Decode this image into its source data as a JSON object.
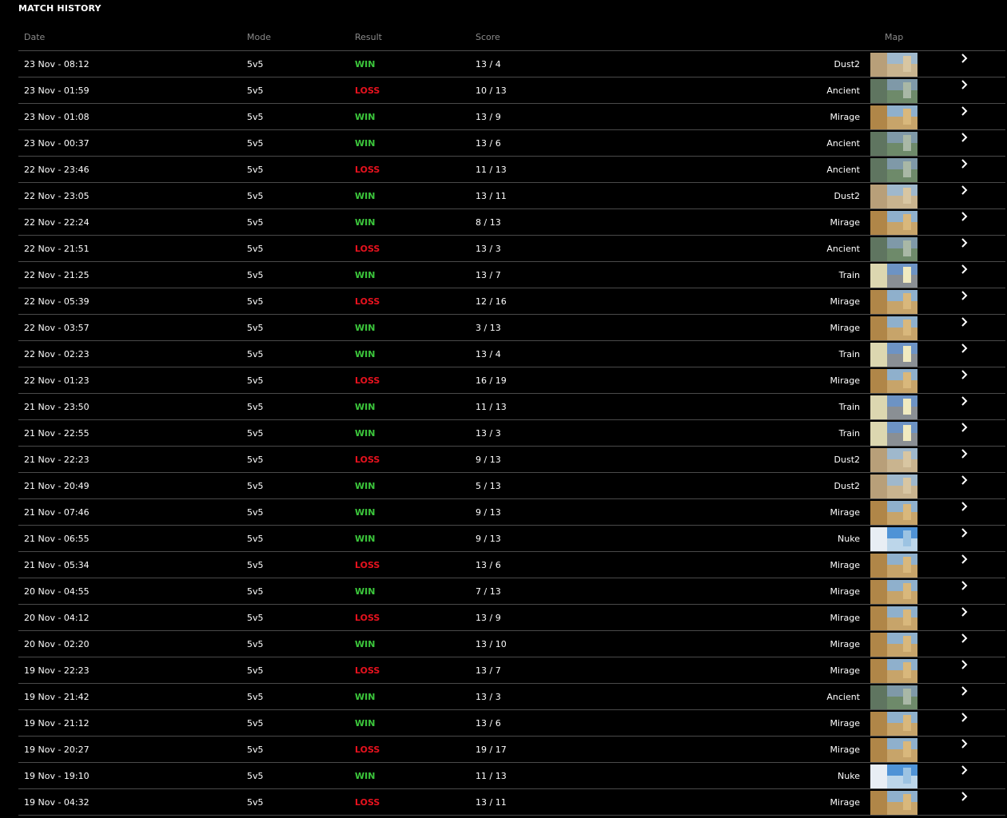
{
  "page": {
    "title": "MATCH HISTORY"
  },
  "colors": {
    "win": "#3cc83c",
    "loss": "#e8121e",
    "header_text": "#8a8a8a",
    "divider": "#4a4a4a"
  },
  "columns": {
    "date": "Date",
    "mode": "Mode",
    "result": "Result",
    "score": "Score",
    "map": "Map"
  },
  "row_action_icon": "chevron-right-icon",
  "matches": [
    {
      "date": "23 Nov - 08:12",
      "mode": "5v5",
      "result": "WIN",
      "score": "13 / 4",
      "map": "Dust2"
    },
    {
      "date": "23 Nov - 01:59",
      "mode": "5v5",
      "result": "LOSS",
      "score": "10 / 13",
      "map": "Ancient"
    },
    {
      "date": "23 Nov - 01:08",
      "mode": "5v5",
      "result": "WIN",
      "score": "13 / 9",
      "map": "Mirage"
    },
    {
      "date": "23 Nov - 00:37",
      "mode": "5v5",
      "result": "WIN",
      "score": "13 / 6",
      "map": "Ancient"
    },
    {
      "date": "22 Nov - 23:46",
      "mode": "5v5",
      "result": "LOSS",
      "score": "11 / 13",
      "map": "Ancient"
    },
    {
      "date": "22 Nov - 23:05",
      "mode": "5v5",
      "result": "WIN",
      "score": "13 / 11",
      "map": "Dust2"
    },
    {
      "date": "22 Nov - 22:24",
      "mode": "5v5",
      "result": "WIN",
      "score": "8 / 13",
      "map": "Mirage"
    },
    {
      "date": "22 Nov - 21:51",
      "mode": "5v5",
      "result": "LOSS",
      "score": "13 / 3",
      "map": "Ancient"
    },
    {
      "date": "22 Nov - 21:25",
      "mode": "5v5",
      "result": "WIN",
      "score": "13 / 7",
      "map": "Train"
    },
    {
      "date": "22 Nov - 05:39",
      "mode": "5v5",
      "result": "LOSS",
      "score": "12 / 16",
      "map": "Mirage"
    },
    {
      "date": "22 Nov - 03:57",
      "mode": "5v5",
      "result": "WIN",
      "score": "3 / 13",
      "map": "Mirage"
    },
    {
      "date": "22 Nov - 02:23",
      "mode": "5v5",
      "result": "WIN",
      "score": "13 / 4",
      "map": "Train"
    },
    {
      "date": "22 Nov - 01:23",
      "mode": "5v5",
      "result": "LOSS",
      "score": "16 / 19",
      "map": "Mirage"
    },
    {
      "date": "21 Nov - 23:50",
      "mode": "5v5",
      "result": "WIN",
      "score": "11 / 13",
      "map": "Train"
    },
    {
      "date": "21 Nov - 22:55",
      "mode": "5v5",
      "result": "WIN",
      "score": "13 / 3",
      "map": "Train"
    },
    {
      "date": "21 Nov - 22:23",
      "mode": "5v5",
      "result": "LOSS",
      "score": "9 / 13",
      "map": "Dust2"
    },
    {
      "date": "21 Nov - 20:49",
      "mode": "5v5",
      "result": "WIN",
      "score": "5 / 13",
      "map": "Dust2"
    },
    {
      "date": "21 Nov - 07:46",
      "mode": "5v5",
      "result": "WIN",
      "score": "9 / 13",
      "map": "Mirage"
    },
    {
      "date": "21 Nov - 06:55",
      "mode": "5v5",
      "result": "WIN",
      "score": "9 / 13",
      "map": "Nuke"
    },
    {
      "date": "21 Nov - 05:34",
      "mode": "5v5",
      "result": "LOSS",
      "score": "13 / 6",
      "map": "Mirage"
    },
    {
      "date": "20 Nov - 04:55",
      "mode": "5v5",
      "result": "WIN",
      "score": "7 / 13",
      "map": "Mirage"
    },
    {
      "date": "20 Nov - 04:12",
      "mode": "5v5",
      "result": "LOSS",
      "score": "13 / 9",
      "map": "Mirage"
    },
    {
      "date": "20 Nov - 02:20",
      "mode": "5v5",
      "result": "WIN",
      "score": "13 / 10",
      "map": "Mirage"
    },
    {
      "date": "19 Nov - 22:23",
      "mode": "5v5",
      "result": "LOSS",
      "score": "13 / 7",
      "map": "Mirage"
    },
    {
      "date": "19 Nov - 21:42",
      "mode": "5v5",
      "result": "WIN",
      "score": "13 / 3",
      "map": "Ancient"
    },
    {
      "date": "19 Nov - 21:12",
      "mode": "5v5",
      "result": "WIN",
      "score": "13 / 6",
      "map": "Mirage"
    },
    {
      "date": "19 Nov - 20:27",
      "mode": "5v5",
      "result": "LOSS",
      "score": "19 / 17",
      "map": "Mirage"
    },
    {
      "date": "19 Nov - 19:10",
      "mode": "5v5",
      "result": "WIN",
      "score": "11 / 13",
      "map": "Nuke"
    },
    {
      "date": "19 Nov - 04:32",
      "mode": "5v5",
      "result": "LOSS",
      "score": "13 / 11",
      "map": "Mirage"
    }
  ]
}
